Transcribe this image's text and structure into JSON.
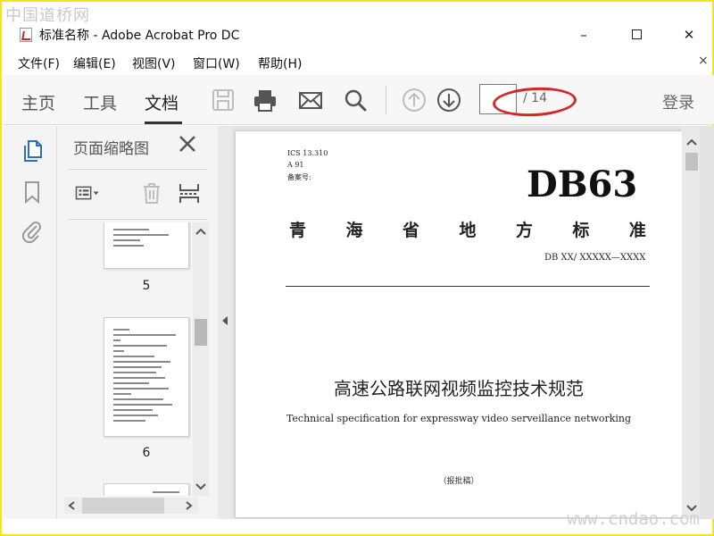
{
  "watermark": {
    "top": "中国道桥网",
    "bottom": "www.cndao.com"
  },
  "window": {
    "title": "标准名称 - Adobe Acrobat Pro DC",
    "minimize": "–",
    "close": "✕"
  },
  "menu": {
    "items": [
      "文件(F)",
      "编辑(E)",
      "视图(V)",
      "窗口(W)",
      "帮助(H)"
    ],
    "close": "×"
  },
  "toolbar": {
    "tabs": [
      "主页",
      "工具",
      "文档"
    ],
    "active_tab": "文档",
    "icons": [
      "save-icon",
      "print-icon",
      "mail-icon",
      "search-icon",
      "page-up-icon",
      "page-down-icon"
    ],
    "page_total": "/ 14",
    "login": "登录",
    "annotation_color": "#d62626"
  },
  "rail": {
    "icons": [
      "pages-icon",
      "bookmark-icon",
      "attachment-icon"
    ],
    "accent": "#2b6fc0"
  },
  "thumbnails": {
    "title": "页面缩略图",
    "pages": [
      {
        "number": "5"
      },
      {
        "number": "6"
      }
    ]
  },
  "document": {
    "ics": "ICS 13.310",
    "category": "A 91",
    "filing": "备案号:",
    "code": "DB63",
    "standard_name": [
      "青",
      "海",
      "省",
      "地",
      "方",
      "标",
      "准"
    ],
    "number": "DB XX/  XXXXX—XXXX",
    "title_cn": "高速公路联网视频监控技术规范",
    "title_en": "Technical specification for expressway video serveillance networking",
    "status": "（报批稿）"
  }
}
